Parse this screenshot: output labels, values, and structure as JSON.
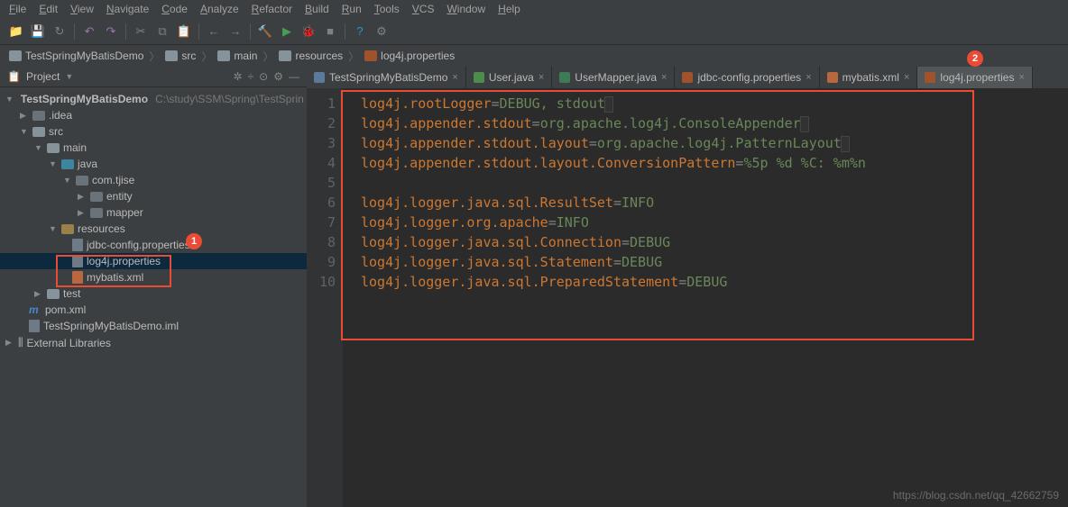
{
  "menu": [
    "File",
    "Edit",
    "View",
    "Navigate",
    "Code",
    "Analyze",
    "Refactor",
    "Build",
    "Run",
    "Tools",
    "VCS",
    "Window",
    "Help"
  ],
  "breadcrumbs": [
    "TestSpringMyBatisDemo",
    "src",
    "main",
    "resources",
    "log4j.properties"
  ],
  "panel": {
    "title": "Project"
  },
  "tree": {
    "root": "TestSpringMyBatisDemo",
    "root_path": "C:\\study\\SSM\\Spring\\TestSprin",
    "idea": ".idea",
    "src": "src",
    "main": "main",
    "java": "java",
    "pkg": "com.tjise",
    "entity": "entity",
    "mapper": "mapper",
    "resources": "resources",
    "jdbc": "jdbc-config.properties",
    "log4j": "log4j.properties",
    "mybatis": "mybatis.xml",
    "test": "test",
    "pom": "pom.xml",
    "iml": "TestSpringMyBatisDemo.iml",
    "ext": "External Libraries"
  },
  "tabs": [
    {
      "label": "TestSpringMyBatisDemo",
      "color": "#5c7a99",
      "active": false
    },
    {
      "label": "User.java",
      "color": "#4e8c4e",
      "active": false
    },
    {
      "label": "UserMapper.java",
      "color": "#3f7a57",
      "active": false
    },
    {
      "label": "jdbc-config.properties",
      "color": "#a0522d",
      "active": false
    },
    {
      "label": "mybatis.xml",
      "color": "#b8673e",
      "active": false
    },
    {
      "label": "log4j.properties",
      "color": "#a0522d",
      "active": true
    }
  ],
  "code": [
    {
      "n": 1,
      "k": "log4j.rootLogger",
      "v": "DEBUG, stdout"
    },
    {
      "n": 2,
      "k": "log4j.appender.stdout",
      "v": "org.apache.log4j.ConsoleAppender"
    },
    {
      "n": 3,
      "k": "log4j.appender.stdout.layout",
      "v": "org.apache.log4j.PatternLayout"
    },
    {
      "n": 4,
      "k": "log4j.appender.stdout.layout.ConversionPattern",
      "v": "%5p %d %C: %m%n"
    },
    {
      "n": 5,
      "k": "",
      "v": ""
    },
    {
      "n": 6,
      "k": "log4j.logger.java.sql.ResultSet",
      "v": "INFO"
    },
    {
      "n": 7,
      "k": "log4j.logger.org.apache",
      "v": "INFO"
    },
    {
      "n": 8,
      "k": "log4j.logger.java.sql.Connection",
      "v": "DEBUG"
    },
    {
      "n": 9,
      "k": "log4j.logger.java.sql.Statement",
      "v": "DEBUG"
    },
    {
      "n": 10,
      "k": "log4j.logger.java.sql.PreparedStatement",
      "v": "DEBUG"
    }
  ],
  "annotations": {
    "callout1": "1",
    "callout2": "2"
  },
  "watermark": "https://blog.csdn.net/qq_42662759"
}
